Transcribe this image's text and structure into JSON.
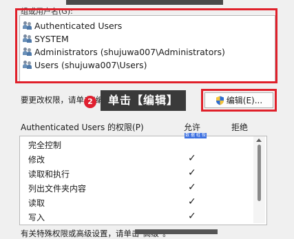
{
  "group": {
    "label": "组或用户名(G):",
    "users": [
      {
        "name": "Authenticated Users",
        "icon": "user-group-icon"
      },
      {
        "name": "SYSTEM",
        "icon": "user-group-icon"
      },
      {
        "name": "Administrators (shujuwa007\\Administrators)",
        "icon": "user-group-icon"
      },
      {
        "name": "Users (shujuwa007\\Users)",
        "icon": "user-group-icon"
      }
    ]
  },
  "change_hint": "要更改权限，请单击\"编辑\"。",
  "step_badge": "2",
  "callout": "单击【编辑】",
  "edit_button": {
    "label": "编辑(E)...",
    "icon": "uac-shield-icon"
  },
  "permissions": {
    "title": "Authenticated Users 的权限(P)",
    "allow_header": "允许",
    "deny_header": "拒绝",
    "watermark": "数 据 蛙 恢 复",
    "rows": [
      {
        "label": "完全控制",
        "allow": ""
      },
      {
        "label": "修改",
        "allow": "✓"
      },
      {
        "label": "读取和执行",
        "allow": "✓"
      },
      {
        "label": "列出文件夹内容",
        "allow": "✓"
      },
      {
        "label": "读取",
        "allow": "✓"
      },
      {
        "label": "写入",
        "allow": "✓"
      }
    ]
  },
  "bottom_hint": "有关特殊权限或高级设置，请单击\"高级\"。",
  "colors": {
    "highlight": "#e0202a",
    "callout_bg": "#3a3a3a",
    "badge": "#e02030"
  }
}
